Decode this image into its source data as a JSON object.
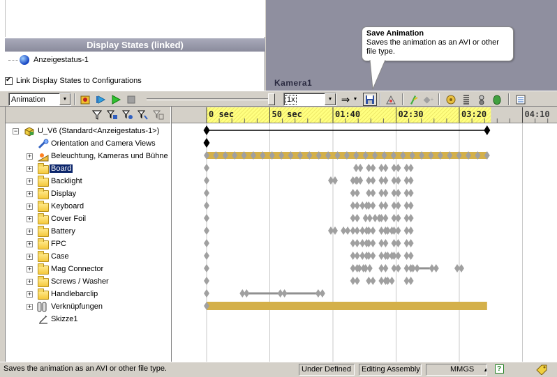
{
  "display_states": {
    "header": "Display States (linked)",
    "item": "Anzeigestatus-1",
    "link_checkbox_label": "Link Display States to Configurations",
    "link_checked": true
  },
  "viewport": {
    "camera_label": "Kamera1"
  },
  "tooltip": {
    "title": "Save Animation",
    "body": "Saves the animation as an AVI or other file type."
  },
  "toolbar": {
    "study_type": "Animation",
    "playback_speed": "1x"
  },
  "timeline": {
    "ticks": [
      "0 sec",
      "50 sec",
      "01:40",
      "02:30",
      "03:20",
      "04:10"
    ],
    "highlight_color": "#ffff80",
    "bar_color": "#d4b04a",
    "key_color": "#a0a0a0"
  },
  "tree": {
    "root_label": "U_V6  (Standard<Anzeigestatus-1>)",
    "items": [
      {
        "label": "Orientation and Camera Views",
        "icon": "camera-views-icon",
        "expandable": false
      },
      {
        "label": "Beleuchtung, Kameras und Bühne",
        "icon": "lights-icon",
        "expandable": true
      },
      {
        "label": "Board",
        "icon": "folder-icon",
        "expandable": true,
        "selected": true
      },
      {
        "label": "Backlight",
        "icon": "folder-icon",
        "expandable": true
      },
      {
        "label": "Display",
        "icon": "folder-icon",
        "expandable": true
      },
      {
        "label": "Keyboard",
        "icon": "folder-icon",
        "expandable": true
      },
      {
        "label": "Cover Foil",
        "icon": "folder-icon",
        "expandable": true
      },
      {
        "label": "Battery",
        "icon": "folder-icon",
        "expandable": true
      },
      {
        "label": "FPC",
        "icon": "folder-icon",
        "expandable": true
      },
      {
        "label": "Case",
        "icon": "folder-icon",
        "expandable": true
      },
      {
        "label": "Mag Connector",
        "icon": "folder-icon",
        "expandable": true
      },
      {
        "label": "Screws / Washer",
        "icon": "folder-icon",
        "expandable": true
      },
      {
        "label": "Handlebarclip",
        "icon": "folder-icon",
        "expandable": true
      },
      {
        "label": "Verknüpfungen",
        "icon": "mates-icon",
        "expandable": true
      },
      {
        "label": "Skizze1",
        "icon": "sketch-icon",
        "expandable": false
      }
    ]
  },
  "statusbar": {
    "message": "Saves the animation as an AVI or other file type.",
    "definition": "Under Defined",
    "mode": "Editing Assembly",
    "units": "MMGS",
    "help": "?"
  }
}
